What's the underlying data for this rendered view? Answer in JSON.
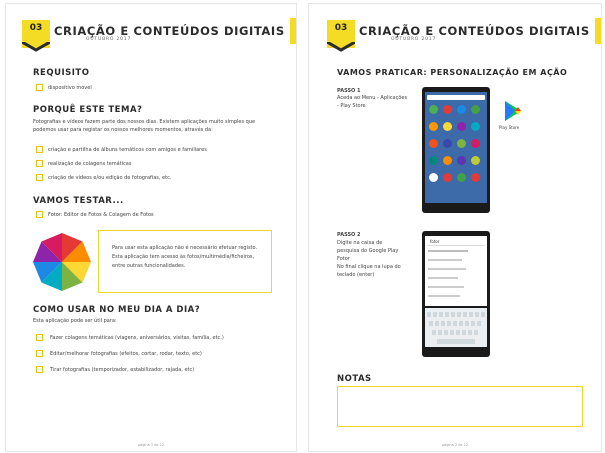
{
  "left": {
    "badge": "03",
    "title": "CRIAÇÃO E CONTEÚDOS DIGITAIS",
    "subtitle": "OUTUBRO 2017",
    "requisito": {
      "heading": "REQUISITO",
      "item": "dispositivo móvel"
    },
    "porque": {
      "heading": "PORQUÊ ESTE TEMA?",
      "line1": "Fotografias e vídeos fazem parte dos nossos dias. Existem aplicações muito simples que",
      "line2": "podemos usar para registar os nossos melhores momentos, através da:",
      "items": [
        "criação e partilha de álbuns temáticos com amigos e familiares",
        "realização de colagens temáticas",
        "criação de vídeos e/ou edição de fotografias, etc."
      ]
    },
    "testar": {
      "heading": "VAMOS TESTAR...",
      "item": "Fotor: Editor de Fotos & Colagem de Fotos",
      "info1": "Para usar esta aplicação não é necessário efetuar registo.",
      "info2": "Esta aplicação tem acesso às fotos/multimédia/ficheiros,",
      "info3": "entre outras funcionalidades."
    },
    "usar": {
      "heading": "COMO USAR NO MEU DIA A DIA?",
      "intro": "Esta aplicação pode ser útil para:",
      "items": [
        "Fazer colagens temáticas (viagens, aniversários, visitas, família, etc.)",
        "Editar/melhorar fotografias (efeitos, cortar, rodar, texto, etc)",
        "Tirar fotografias (temporizador, estabilizador, rajada, etc)"
      ]
    },
    "footer": "página 1 de 12"
  },
  "right": {
    "badge": "03",
    "title": "CRIAÇÃO E CONTEÚDOS DIGITAIS",
    "subtitle": "OUTUBRO 2017",
    "praticar": {
      "heading": "VAMOS PRATICAR: PERSONALIZAÇÃO EM AÇÃO",
      "passo1_title": "PASSO 1",
      "passo1_line1": "Aceda ao Menu - Aplicações",
      "passo1_line2": "- Play Store",
      "playstore_label": "Play Store",
      "passo2_title": "PASSO 2",
      "passo2_line1": "Digite na caixa de",
      "passo2_line2": "pesquisa do Google Play",
      "passo2_line3": "Fotor",
      "passo2_line4": "No final clique na lupa do",
      "passo2_line5": "teclado (enter)",
      "search_text": "fotor"
    },
    "notas": {
      "heading": "NOTAS"
    },
    "footer": "página 2 de 12"
  },
  "colors": {
    "accent": "#f4dc25",
    "dark": "#2b2b2b"
  }
}
